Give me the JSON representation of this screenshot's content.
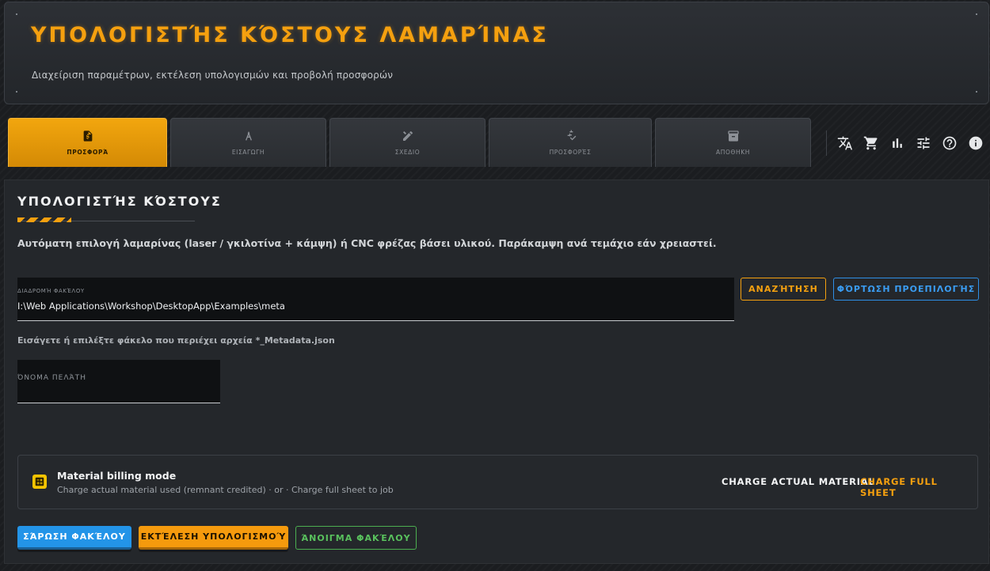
{
  "header": {
    "title": "ΥΠΟΛΟΓΙΣΤΉΣ ΚΌΣΤΟΥΣ ΛΑΜΑΡΊΝΑΣ",
    "subtitle": "Διαχείριση παραμέτρων, εκτέλεση υπολογισμών και προβολή προσφορών"
  },
  "tabs": [
    {
      "label": "ΠΡΟΣΦΟΡΆ",
      "icon": "invoice-icon",
      "active": true
    },
    {
      "label": "ΕΙΣΑΓΩΓΗ",
      "icon": "compass-icon",
      "active": false
    },
    {
      "label": "ΣΧΕΔΙΟ",
      "icon": "design-icon",
      "active": false
    },
    {
      "label": "ΠΡΟΣΦΟΡΈΣ",
      "icon": "price-check-icon",
      "active": false
    },
    {
      "label": "ΑΠΟΘΗΚΗ",
      "icon": "archive-icon",
      "active": false
    }
  ],
  "toolbar_icons": [
    "translate-icon",
    "cart-icon",
    "bar-chart-icon",
    "tune-icon",
    "help-icon",
    "info-icon"
  ],
  "main": {
    "section_title": "ΥΠΟΛΟΓΙΣΤΉΣ ΚΌΣΤΟΥΣ",
    "description": "Αυτόματη επιλογή λαμαρίνας (laser / γκιλοτίνα + κάμψη) ή CNC φρέζας βάσει υλικού. Παράκαμψη ανά τεμάχιο εάν χρειαστεί.",
    "folder_field": {
      "label": "ΔΙΑΔΡΟΜΉ ΦΑΚΈΛΟΥ",
      "value": "I:\\Web Applications\\Workshop\\DesktopApp\\Examples\\meta"
    },
    "search_button": "ΑΝΑΖΉΤΗΣΗ",
    "preset_button": "ΦΌΡΤΩΣΗ ΠΡΟΕΠΙΛΟΓΉΣ",
    "folder_hint": "Εισάγετε ή επιλέξτε φάκελο που περιέχει αρχεία *_Metadata.json",
    "customer_field": {
      "label": "ΌΝΟΜΑ ΠΕΛΆΤΗ",
      "value": ""
    },
    "billing": {
      "title": "Material billing mode",
      "subtitle": "Charge actual material used (remnant credited) · or · Charge full sheet to job",
      "option_actual": "CHARGE ACTUAL MATERIAL",
      "option_full": "CHARGE FULL SHEET",
      "selected": "CHARGE FULL SHEET"
    },
    "actions": {
      "scan": "ΣΆΡΩΣΗ ΦΑΚΈΛΟΥ",
      "run": "ΕΚΤΈΛΕΣΗ ΥΠΟΛΟΓΙΣΜΟΎ",
      "open": "ΆΝΟΙΓΜΑ ΦΑΚΈΛΟΥ"
    }
  },
  "colors": {
    "accent": "#f5a00f",
    "blue": "#2394e8",
    "green": "#4caf50",
    "background": "#1b1d20"
  }
}
